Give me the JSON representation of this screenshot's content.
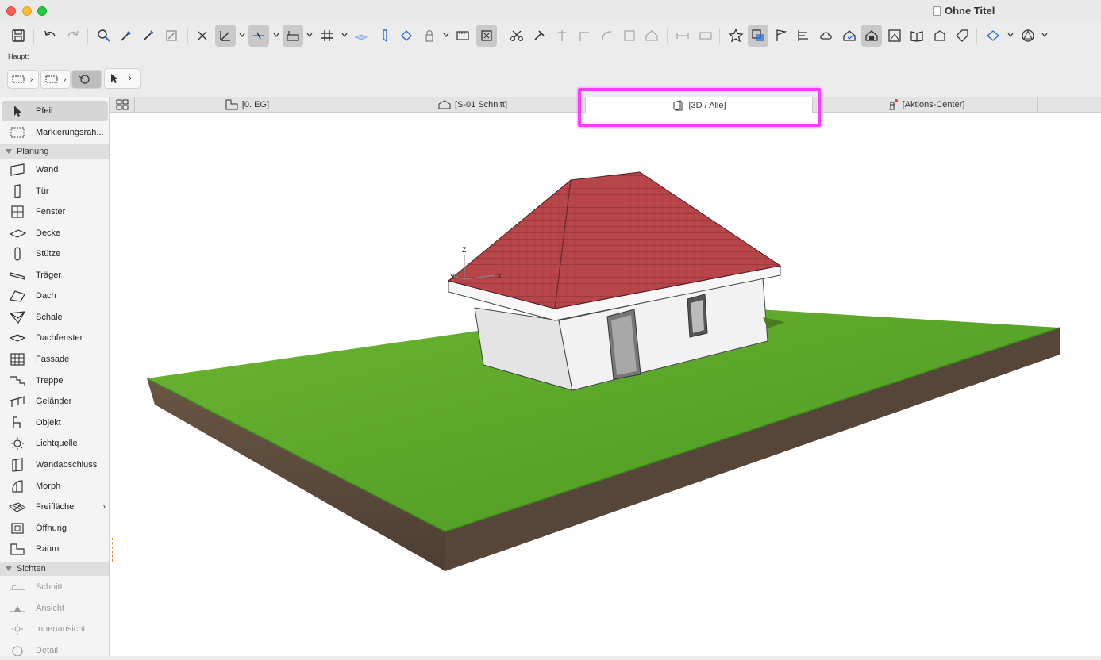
{
  "window": {
    "title": "Ohne Titel"
  },
  "infobox": {
    "label": "Haupt:"
  },
  "sidebar": {
    "top_items": [
      {
        "label": "Pfeil",
        "icon": "arrow-pointer-icon",
        "selected": true
      },
      {
        "label": "Markierungsrah...",
        "icon": "marquee-icon",
        "selected": false
      }
    ],
    "section_planung": "Planung",
    "planung_items": [
      {
        "label": "Wand",
        "icon": "wall-icon"
      },
      {
        "label": "Tür",
        "icon": "door-icon"
      },
      {
        "label": "Fenster",
        "icon": "window-icon"
      },
      {
        "label": "Decke",
        "icon": "slab-icon"
      },
      {
        "label": "Stütze",
        "icon": "column-icon"
      },
      {
        "label": "Träger",
        "icon": "beam-icon"
      },
      {
        "label": "Dach",
        "icon": "roof-icon"
      },
      {
        "label": "Schale",
        "icon": "shell-icon"
      },
      {
        "label": "Dachfenster",
        "icon": "skylight-icon"
      },
      {
        "label": "Fassade",
        "icon": "curtain-wall-icon"
      },
      {
        "label": "Treppe",
        "icon": "stair-icon"
      },
      {
        "label": "Geländer",
        "icon": "railing-icon"
      },
      {
        "label": "Objekt",
        "icon": "object-icon"
      },
      {
        "label": "Lichtquelle",
        "icon": "lamp-icon"
      },
      {
        "label": "Wandabschluss",
        "icon": "wall-end-icon"
      },
      {
        "label": "Morph",
        "icon": "morph-icon"
      },
      {
        "label": "Freifläche",
        "icon": "mesh-icon"
      },
      {
        "label": "Öffnung",
        "icon": "opening-icon"
      },
      {
        "label": "Raum",
        "icon": "zone-icon"
      }
    ],
    "section_sichten": "Sichten",
    "sichten_items": [
      {
        "label": "Schnitt",
        "icon": "section-icon"
      },
      {
        "label": "Ansicht",
        "icon": "elevation-icon"
      },
      {
        "label": "Innenansicht",
        "icon": "interior-elevation-icon"
      },
      {
        "label": "Detail",
        "icon": "detail-icon"
      }
    ]
  },
  "tabs": [
    {
      "label": "[0. EG]",
      "icon": "floor-plan-icon"
    },
    {
      "label": "[S-01 Schnitt]",
      "icon": "section-view-icon"
    },
    {
      "label": "[3D / Alle]",
      "icon": "3d-view-icon",
      "active": true
    },
    {
      "label": "[Aktions-Center]",
      "icon": "action-center-icon"
    }
  ],
  "axes": {
    "z": "Z",
    "x": "X",
    "y": "Y"
  },
  "colors": {
    "highlight": "#ff3bff",
    "roof": "#b8454a",
    "grass": "#5aa62a",
    "soil": "#5b4a3a"
  }
}
